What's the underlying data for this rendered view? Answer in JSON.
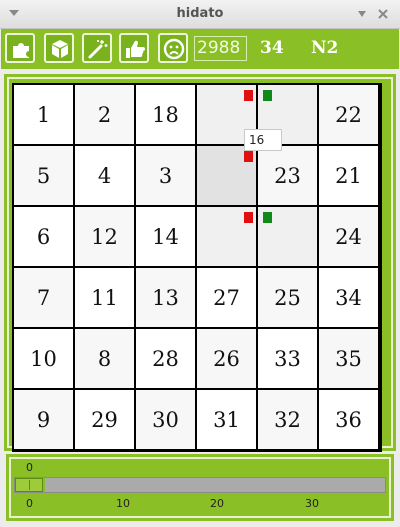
{
  "window": {
    "title": "hidato"
  },
  "toolbar": {
    "tools": [
      {
        "icon": "puzzle-icon"
      },
      {
        "icon": "cube-icon"
      },
      {
        "icon": "magic-wand-icon"
      },
      {
        "icon": "thumbs-up-icon"
      },
      {
        "icon": "sad-face-icon"
      }
    ],
    "score": "2988",
    "count": "34",
    "level": "N2"
  },
  "board": {
    "rows": [
      [
        "1",
        "2",
        "18",
        "",
        "",
        "22"
      ],
      [
        "5",
        "4",
        "3",
        "",
        "23",
        "21"
      ],
      [
        "6",
        "12",
        "14",
        "",
        "",
        "24"
      ],
      [
        "7",
        "11",
        "13",
        "27",
        "25",
        "34"
      ],
      [
        "10",
        "8",
        "28",
        "26",
        "33",
        "35"
      ],
      [
        "9",
        "29",
        "30",
        "31",
        "32",
        "36"
      ]
    ],
    "tooltip": "16"
  },
  "slider": {
    "value": "0",
    "fill_fraction": 0.08,
    "ticks": [
      "0",
      "10",
      "20",
      "30"
    ]
  },
  "colors": {
    "accent": "#8bbf26",
    "marker_red": "#e11010",
    "marker_green": "#0f8a1a"
  }
}
